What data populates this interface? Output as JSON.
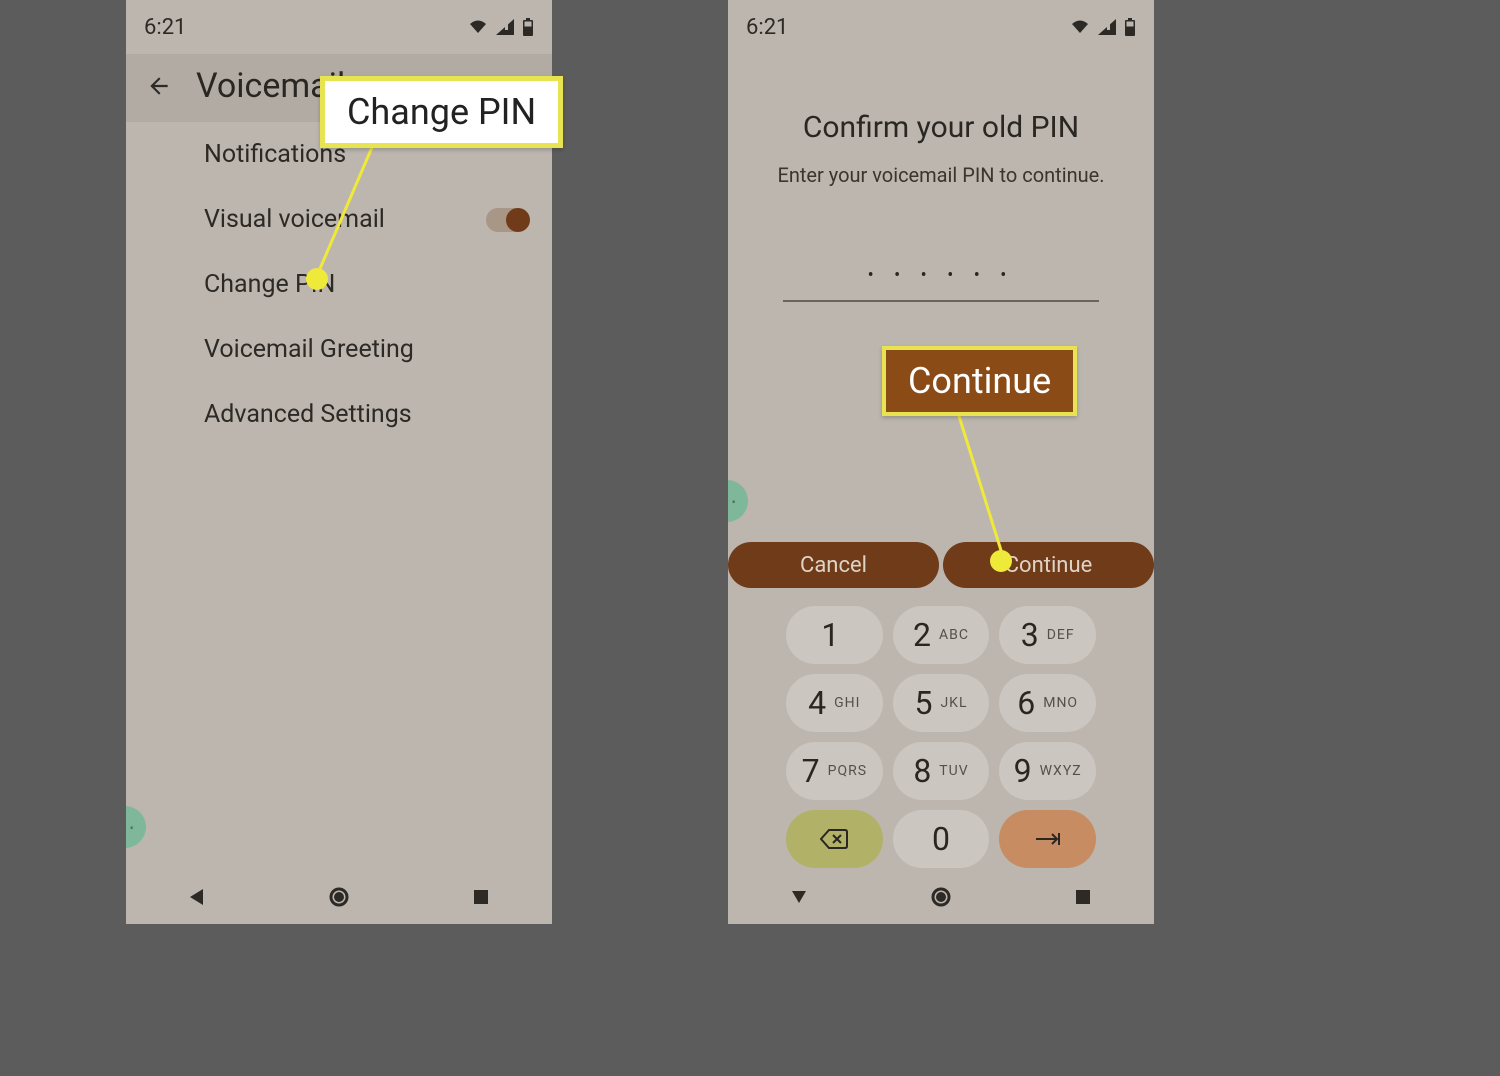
{
  "status": {
    "time": "6:21"
  },
  "left": {
    "header": "Voicemail",
    "items": {
      "notifications": "Notifications",
      "visual_vm": "Visual voicemail",
      "change_pin": "Change PIN",
      "greeting": "Voicemail Greeting",
      "advanced": "Advanced Settings"
    }
  },
  "right": {
    "title": "Confirm your old PIN",
    "subtitle": "Enter your voicemail PIN to continue.",
    "pin_mask": "• • • • • •",
    "cancel": "Cancel",
    "continue": "Continue"
  },
  "keypad": {
    "k1": {
      "num": "1",
      "sub": ""
    },
    "k2": {
      "num": "2",
      "sub": "ABC"
    },
    "k3": {
      "num": "3",
      "sub": "DEF"
    },
    "k4": {
      "num": "4",
      "sub": "GHI"
    },
    "k5": {
      "num": "5",
      "sub": "JKL"
    },
    "k6": {
      "num": "6",
      "sub": "MNO"
    },
    "k7": {
      "num": "7",
      "sub": "PQRS"
    },
    "k8": {
      "num": "8",
      "sub": "TUV"
    },
    "k9": {
      "num": "9",
      "sub": "WXYZ"
    },
    "k0": {
      "num": "0",
      "sub": ""
    }
  },
  "annotations": {
    "change_pin_callout": "Change PIN",
    "continue_callout": "Continue"
  }
}
